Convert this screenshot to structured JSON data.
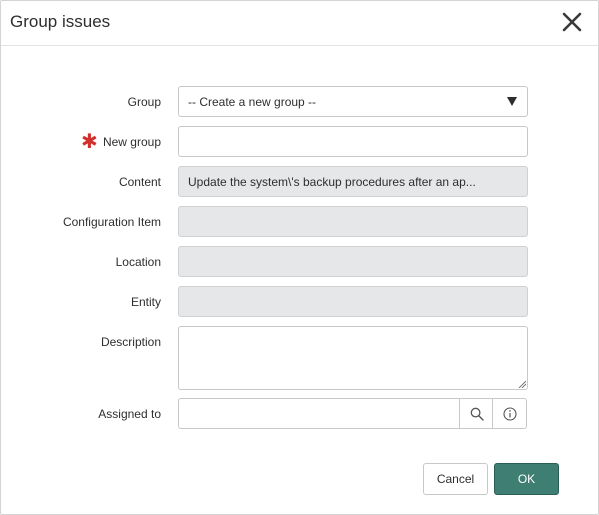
{
  "dialog": {
    "title": "Group issues",
    "close_icon": "close-icon"
  },
  "form": {
    "group": {
      "label": "Group",
      "value": "-- Create a new group --"
    },
    "new_group": {
      "label": "New group",
      "required_marker": "✱",
      "value": ""
    },
    "content": {
      "label": "Content",
      "value": "Update the system\\'s backup procedures after an ap..."
    },
    "configuration_item": {
      "label": "Configuration Item",
      "value": ""
    },
    "location": {
      "label": "Location",
      "value": ""
    },
    "entity": {
      "label": "Entity",
      "value": ""
    },
    "description": {
      "label": "Description",
      "value": ""
    },
    "assigned_to": {
      "label": "Assigned to",
      "value": "",
      "search_icon": "search-icon",
      "info_icon": "info-icon"
    }
  },
  "buttons": {
    "cancel_label": "Cancel",
    "ok_label": "OK"
  },
  "colors": {
    "primary": "#3f7e72",
    "required": "#d0312d",
    "readonly_bg": "#e6e7e8"
  }
}
